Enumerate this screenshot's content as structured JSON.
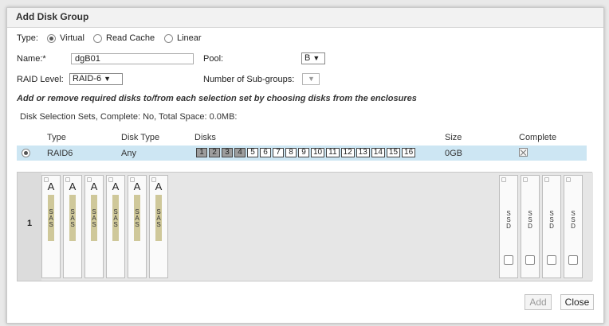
{
  "dialog": {
    "title": "Add Disk Group",
    "type": {
      "label": "Type:",
      "options": [
        {
          "label": "Virtual",
          "selected": true
        },
        {
          "label": "Read Cache",
          "selected": false
        },
        {
          "label": "Linear",
          "selected": false
        }
      ]
    },
    "name": {
      "label": "Name:*",
      "value": "dgB01"
    },
    "pool": {
      "label": "Pool:",
      "value": "B"
    },
    "raid_level": {
      "label": "RAID Level:",
      "value": "RAID-6"
    },
    "sub_groups": {
      "label": "Number of Sub-groups:",
      "value": ""
    },
    "instruction": "Add or remove required disks to/from each selection set by choosing disks from the enclosures",
    "selection_summary": "Disk Selection Sets, Complete: No, Total Space: 0.0MB:",
    "table": {
      "headers": {
        "type": "Type",
        "disk_type": "Disk Type",
        "disks": "Disks",
        "size": "Size",
        "complete": "Complete"
      },
      "rows": [
        {
          "type": "RAID6",
          "disk_type": "Any",
          "disks": [
            {
              "n": "1",
              "selected": true
            },
            {
              "n": "2",
              "selected": true
            },
            {
              "n": "3",
              "selected": true
            },
            {
              "n": "4",
              "selected": true
            },
            {
              "n": "5",
              "selected": false
            },
            {
              "n": "6",
              "selected": false
            },
            {
              "n": "7",
              "selected": false
            },
            {
              "n": "8",
              "selected": false
            },
            {
              "n": "9",
              "selected": false
            },
            {
              "n": "10",
              "selected": false
            },
            {
              "n": "11",
              "selected": false
            },
            {
              "n": "12",
              "selected": false
            },
            {
              "n": "13",
              "selected": false
            },
            {
              "n": "14",
              "selected": false
            },
            {
              "n": "15",
              "selected": false
            },
            {
              "n": "16",
              "selected": false
            }
          ],
          "size": "0GB",
          "complete": false
        }
      ]
    },
    "enclosure": {
      "number": "1",
      "left_slots": [
        {
          "letter": "A",
          "media": "SAS"
        },
        {
          "letter": "A",
          "media": "SAS"
        },
        {
          "letter": "A",
          "media": "SAS"
        },
        {
          "letter": "A",
          "media": "SAS"
        },
        {
          "letter": "A",
          "media": "SAS"
        },
        {
          "letter": "A",
          "media": "SAS"
        }
      ],
      "right_slots": [
        {
          "media": "SSD"
        },
        {
          "media": "SSD"
        },
        {
          "media": "SSD"
        },
        {
          "media": "SSD"
        }
      ]
    },
    "buttons": {
      "add": "Add",
      "close": "Close"
    },
    "colors": {
      "selected_row": "#cde6f3",
      "selected_disk": "#9d9d9d",
      "sas_bar": "#cfc89a"
    }
  }
}
